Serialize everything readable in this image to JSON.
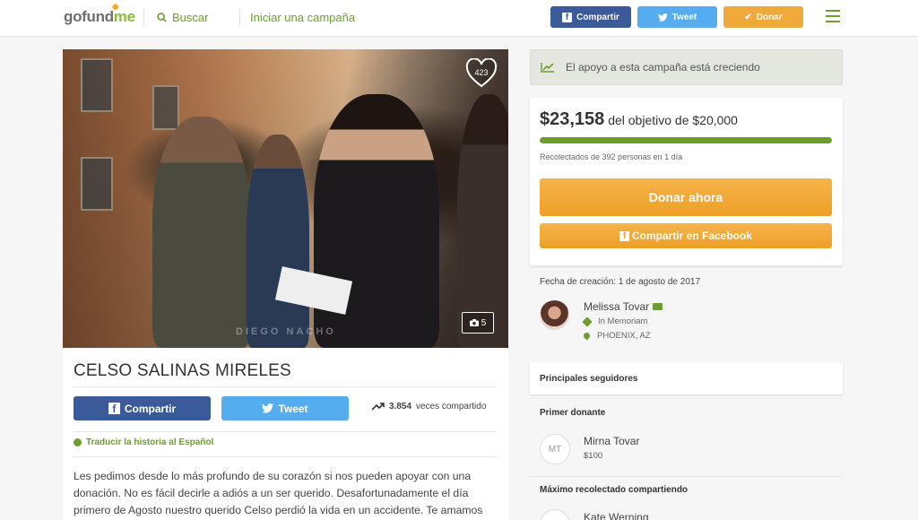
{
  "header": {
    "logo_left": "gofund",
    "logo_right": "me",
    "search_label": "Buscar",
    "start_label": "Iniciar una campaña",
    "share_label": "Compartir",
    "tweet_label": "Tweet",
    "donate_label": "Donar",
    "icons": [
      "search-icon",
      "facebook-icon",
      "twitter-icon",
      "check-icon",
      "hamburger-menu-icon"
    ]
  },
  "photo": {
    "like_count": "423",
    "photo_count": "5",
    "watermark": "DIEGO NACHO"
  },
  "campaign": {
    "title": "CELSO SALINAS MIRELES",
    "share_label": "Compartir",
    "tweet_label": "Tweet",
    "share_count": "3.854",
    "share_suffix": "veces compartido",
    "translate_label": "Traducir la historia al Español",
    "story": "Les pedimos desde lo más profundo de su corazón si nos pueden apoyar con una donación. No es fácil decirle a adiós a un ser querido. Desafortunadamente el día primero de Agosto nuestro querido Celso perdió la vida en un accidente. Te amamos"
  },
  "sidebar": {
    "growing_text": "El apoyo a esta campaña está creciendo",
    "raised_amount": "$23,158",
    "goal_text": "del objetivo de $20,000",
    "progress_fraction": 1.0,
    "raised_by": "Recolectados de 392 personas en 1 día",
    "donate_now_label": "Donar ahora",
    "share_facebook_label": "Compartir en Facebook",
    "created_text": "Fecha de creación: 1 de agosto de 2017",
    "organizer_name": "Melissa Tovar",
    "category": "In Memoriam",
    "location": "PHOENIX, AZ",
    "top_supporters_title": "Principales seguidores",
    "first_donor_title": "Primer donante",
    "first_donor_initials": "MT",
    "first_donor_name": "Mirna Tovar",
    "first_donor_amount": "$100",
    "top_sharer_title": "Máximo recolectado compartiendo",
    "top_sharer_name": "Kate Werning"
  },
  "colors": {
    "brand_green": "#6d9e2e",
    "facebook_blue": "#3b5a99",
    "twitter_blue": "#55acee",
    "donate_orange": "#f2a93b"
  }
}
